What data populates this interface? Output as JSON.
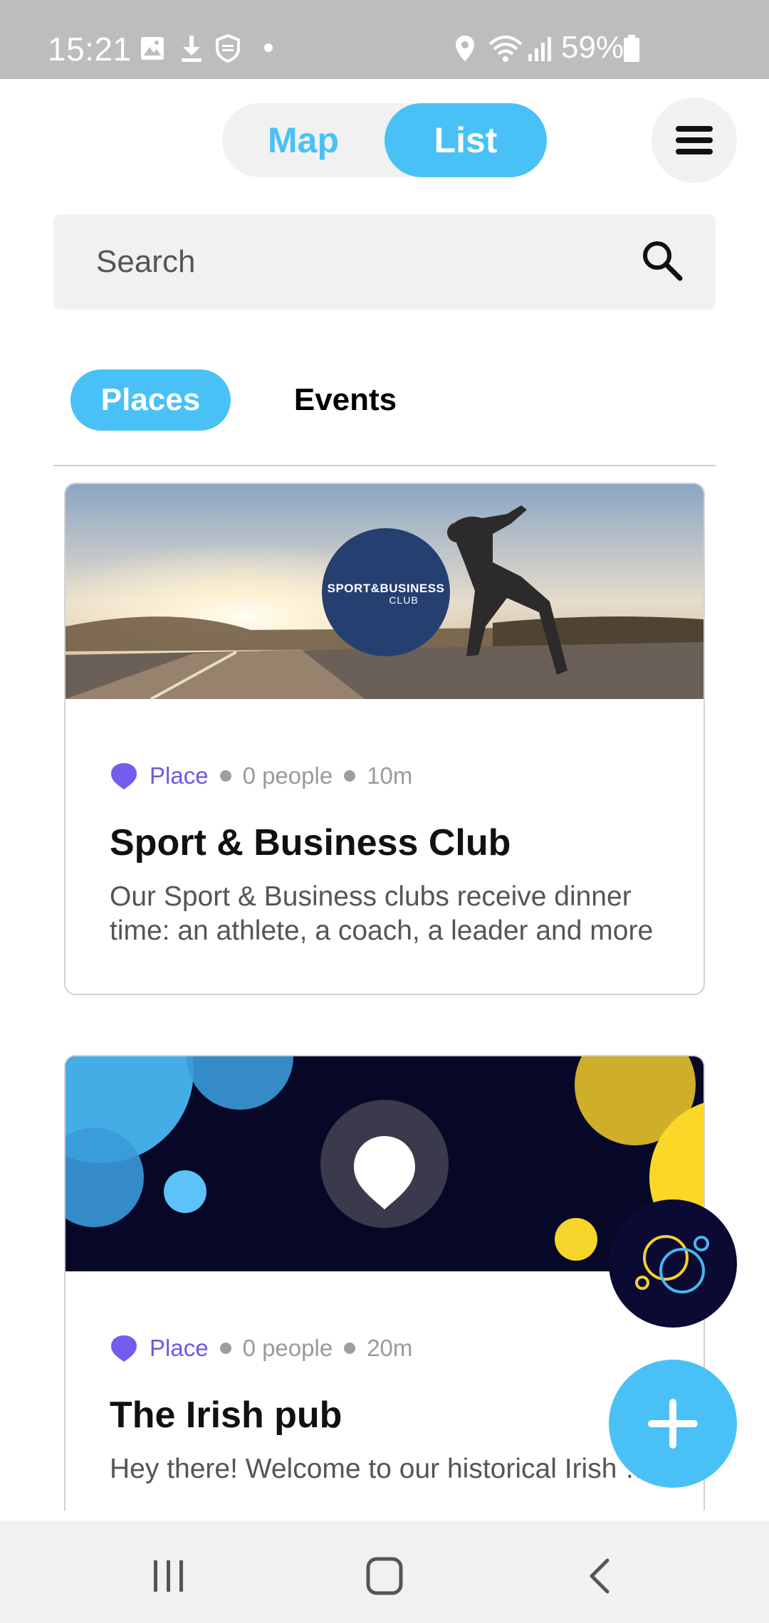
{
  "status_bar": {
    "time": "15:21",
    "battery": "59%",
    "icons": [
      "image-icon",
      "download-icon",
      "shield-icon",
      "dot-icon",
      "location-icon",
      "wifi-icon",
      "signal-icon",
      "battery-icon"
    ]
  },
  "header": {
    "toggle": {
      "map_label": "Map",
      "list_label": "List",
      "selected": "List"
    },
    "menu_icon": "hamburger-menu-icon"
  },
  "search": {
    "placeholder": "Search",
    "value": ""
  },
  "tabs": {
    "places_label": "Places",
    "events_label": "Events",
    "selected": "Places"
  },
  "cards": [
    {
      "type": "Place",
      "people": "0 people",
      "distance": "10m",
      "title": "Sport & Business Club",
      "description": "Our Sport & Business clubs receive dinner time: an athlete, a coach, a leader and more",
      "logo_line1": "SPORT&BUSINESS",
      "logo_line2": "CLUB"
    },
    {
      "type": "Place",
      "people": "0 people",
      "distance": "20m",
      "title": "The Irish pub",
      "description": "Hey there! Welcome to our historical Irish pub"
    }
  ],
  "colors": {
    "accent": "#49c1f7",
    "place_purple": "#6e59e6",
    "navy": "#0b0a33",
    "logo_blue": "#263f71",
    "yellow": "#fbd727"
  },
  "nav_bar": {
    "icons": [
      "recent-apps-icon",
      "home-icon",
      "back-icon"
    ]
  }
}
